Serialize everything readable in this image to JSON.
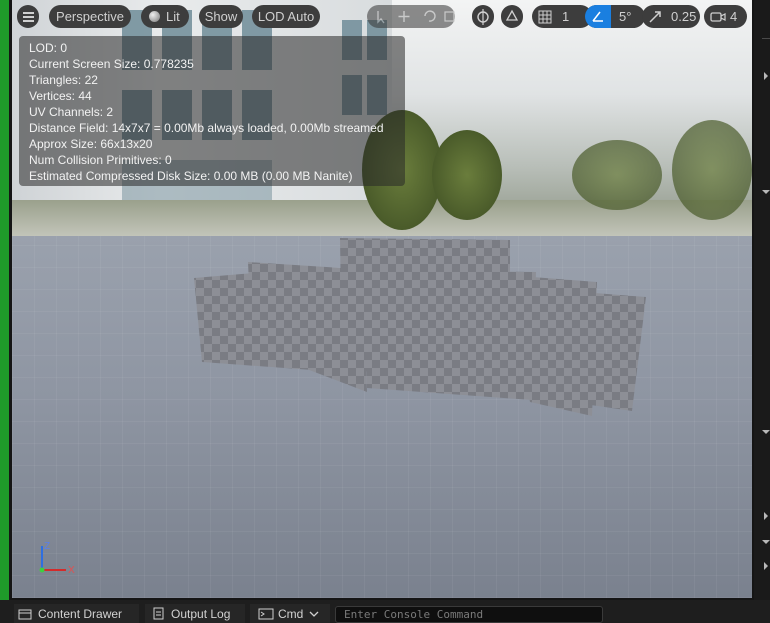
{
  "toolbar": {
    "perspective_label": "Perspective",
    "lit_label": "Lit",
    "show_label": "Show",
    "lod_label": "LOD Auto",
    "grid_value": "1",
    "angle_value": "5°",
    "scale_value": "0.25",
    "camera_speed_value": "4"
  },
  "stats": [
    "LOD:  0",
    "Current Screen Size:  0.778235",
    "Triangles:  22",
    "Vertices:  44",
    "UV Channels:  2",
    "Distance Field:  14x7x7 = 0.00Mb always loaded, 0.00Mb streamed",
    "Approx Size: 66x13x20",
    "Num Collision Primitives:  0",
    "Estimated Compressed Disk Size: 0.00 MB (0.00 MB Nanite)"
  ],
  "gizmo": {
    "z_label": "Z",
    "x_label": "X"
  },
  "bottom_bar": {
    "content_drawer_label": "Content Drawer",
    "output_log_label": "Output Log",
    "cmd_label": "Cmd",
    "console_placeholder": "Enter Console Command"
  },
  "colors": {
    "accent": "#1a7fe0",
    "green_strip": "#1f9a2a"
  }
}
